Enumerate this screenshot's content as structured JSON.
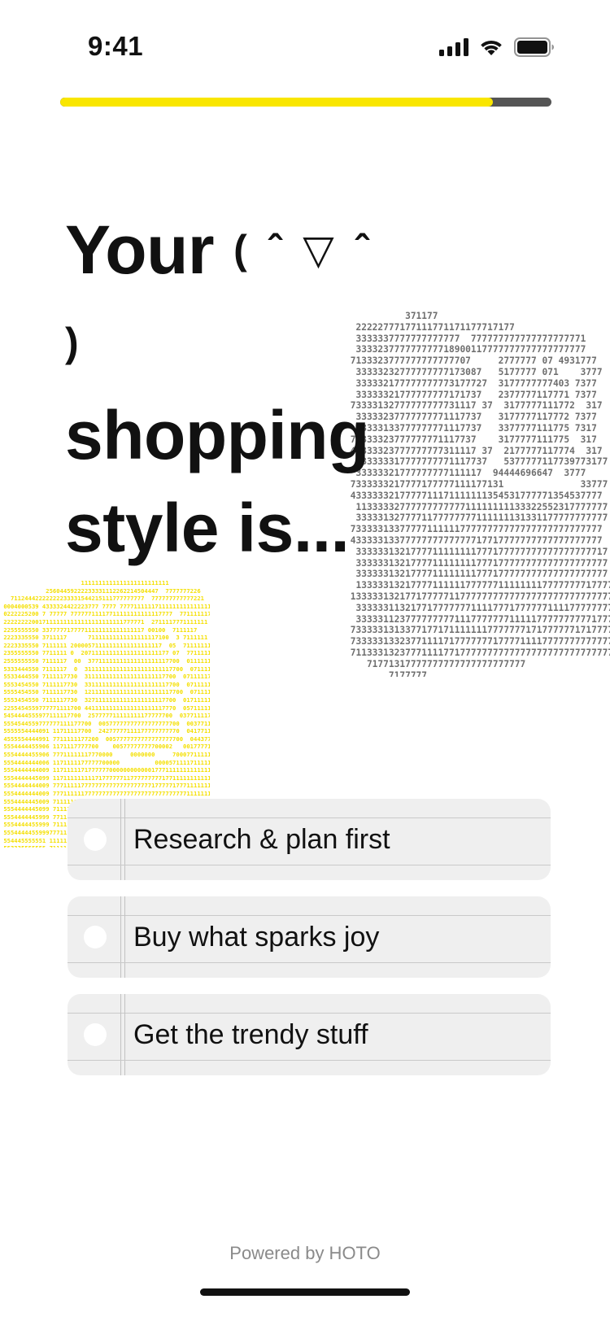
{
  "status_bar": {
    "time": "9:41",
    "icons": [
      "cellular-signal-icon",
      "wifi-icon",
      "battery-icon"
    ]
  },
  "progress": {
    "value": 0.88,
    "fill_color": "#F9E600",
    "track_color": "#555555"
  },
  "question": {
    "title_lines": [
      "Your",
      "shopping",
      "style is..."
    ],
    "kaomoji": "( ˆ ▽ ˆ )"
  },
  "art": {
    "gray": "           371177\n  22222777177111771171177717177\n  3333337777777777777  777777777777777777771\n  333323777777777718900117777777777777777777\n 7133323777777777777707     2777777 07 4931777\n  33333232777777777173087   5177777 071    3777\n  333332177777777773177727  3177777777403 7377\n  33333321777777777171737   2377777117771 7377\n 73333132777777777731117 37  3177777111772  317\n  33333237777777771117737   3177777117772 7377\n  33333133777777771117737   3377777111775 7317\n 73333323777777771117737    3177777111775  317\n 43333323777777777311117 37  2177777117774  317\n  133333317777777771117737   5377777117739773177\n  33333321777777777111117  94444696647  3777\n 7333333217777177777111177131              33777\n 4333333217777711171111111354531777771354537777\n  1133333277777777777711111111133322552317777777\n  3333313277771177777777111111131331177777777777\n 7333331337777711111177777777777777777777777777\n 4333331337777777777777717717777777777777777777\n  3333331321777711111111777177777777777777777717\n  3333331321777711111111777177777777777777777777\n  3333331321777711111111777177777777777777777777\n  1333331321777711111177777711111111777777771777777\n 1333331321771777771177777777777777777777777777777\n  3333331132177177777771111777177777711117777777777\n  3333311237777777771117777777111117777777777177777\n 733333131337717717111111177777771717777771717777777\n 733333133237711117177777771777711117777777777777\n 711333132377711117717777777777777777777777777777777\n    71771317777777777777777777777\n        7177777",
    "yellow": "                       1111111111111111111111111\n             25604459222233331112262214504447  7777777226\n   71124442222222233331544215111777777777  777777777777221\n 0004000539 4333324422223777 7777 777711111171111111111111111\n 0222225200 7 77777 77777711117711111111111117777  7711111177\n 2222222200171111111111111111111111777771  2711117771111111\n 2255555550 33777771777711111111111111117 00100  7111117\n 2223335550 3711117      71111111111111111117100  3 7111111\n 2223335550 7111111 20000571111111111111111117  05  71111111\n 2355555550 7711111 0  2071111111111111111111177 07  77111117\n 2555555550 7111117  00  37711111111111111111117700  01111111\n 5333444550 7111117  0  3111111111111111111111117700  07111117\n 5533444550 7111117730  31111111111111111111117700  07111117\n 5553454550 7111117730  331111111111111111111117700  07111111\n 5555454550 7111117730  1211111111111111111111117700  07111111\n 5553454550 7111117730  32711111111111111111117700  01711111\n 2255454559777771111700 44111111111111111111117770  0571111177\n 5454444555977111117700  257777711111111177777700  0377111177\n 5554544559777777111177700  00577777777777777777700  00377111117\n 5555554444091 11711117700  24277777111177777777770  04177111117\n 4555554444991 7711111177200  0057777777777777777700  0443777111117\n 5554444455906 1171117777700    00577777777700002   0017777111117\n 5554444455906 77711111117770000     0000000     7000771111111111\n 5554444444006 1171111177777700000          000057111171111111111\n 5554444444009 1171111171777777000000000000177711111111111111\n 5554444445099 1171111111117177777711777777777177111111111111\n 5554444444009 7771111177777777777777777777177777177711111111111\n 5554444444009 7771111117777777777777777777777777777711111111111\n 5554444445009 71111111111777711117777777777711111111111111111111\n 5554444445099 7111111111117777777777777777777111111111111111111117\n 5554444445999 77111111111117777777777777777777771111111111111111117\n 5554444455999 711111111111177717777777777777771711111111111111111117\n 555444445599977711111111111177777777777777777771111111111111111117\n 554445555551 1111111\n 553335555555 7111111\n 533335555555 7111111\n 533322255555 7111111\n 533322255555 7111111\n 733322222255 7111111\n  77333222229 7127711\n      772300  7777777"
  },
  "options": [
    {
      "label": "Research & plan first"
    },
    {
      "label": "Buy what sparks joy"
    },
    {
      "label": "Get the trendy stuff"
    }
  ],
  "footer": {
    "powered_by": "Powered by HOTO"
  }
}
